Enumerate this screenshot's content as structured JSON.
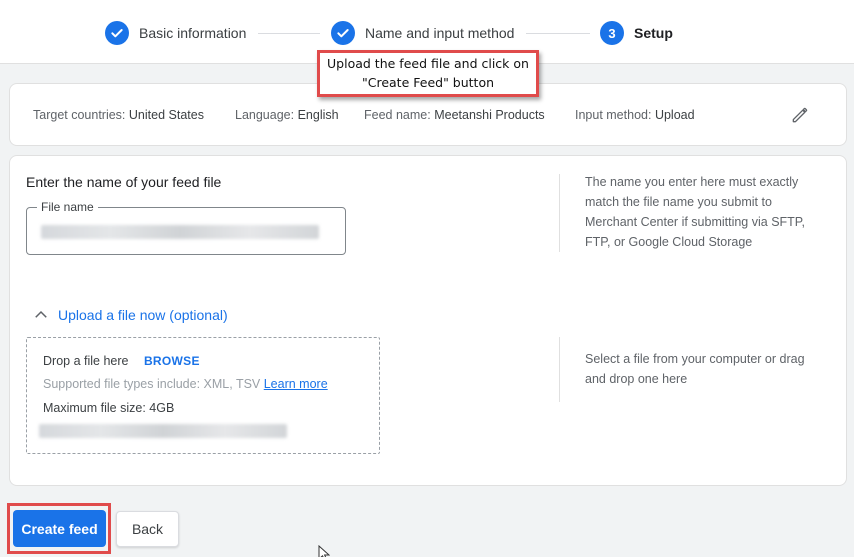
{
  "stepper": {
    "steps": [
      {
        "label": "Basic information",
        "status": "done"
      },
      {
        "label": "Name and input method",
        "status": "done"
      },
      {
        "label": "Setup",
        "status": "current",
        "number": "3"
      }
    ]
  },
  "callout": {
    "line1": "Upload the feed file and click on",
    "line2": "\"Create Feed\" button"
  },
  "summary": {
    "target_countries_label": "Target countries:",
    "target_countries_value": "United States",
    "language_label": "Language:",
    "language_value": "English",
    "feed_name_label": "Feed name:",
    "feed_name_value": "Meetanshi Products",
    "input_method_label": "Input method:",
    "input_method_value": "Upload"
  },
  "feed_file": {
    "title": "Enter the name of your feed file",
    "field_label": "File name",
    "help": "The name you enter here must exactly match the file name you submit to Merchant Center if submitting via SFTP, FTP, or Google Cloud Storage"
  },
  "upload": {
    "toggle_label": "Upload a file now (optional)",
    "drop_text": "Drop a file here",
    "browse": "BROWSE",
    "supported_text": "Supported file types include: XML, TSV",
    "learn_more": "Learn more",
    "max_size": "Maximum file size: 4GB",
    "help": "Select a file from your computer or drag and drop one here"
  },
  "buttons": {
    "create_feed": "Create feed",
    "back": "Back"
  },
  "colors": {
    "accent": "#1a73e8",
    "highlight": "#e04b4b"
  }
}
